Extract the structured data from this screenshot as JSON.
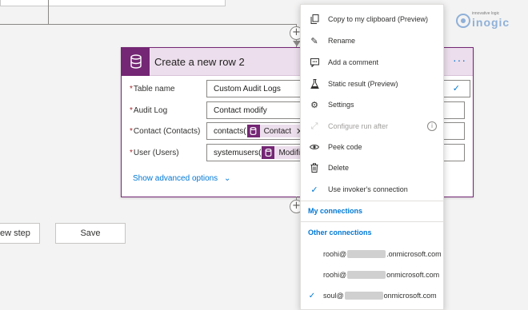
{
  "card": {
    "title": "Create a new row 2",
    "more_label": "···",
    "fields": [
      {
        "label": "Table name",
        "value": "Custom Audit Logs"
      },
      {
        "label": "Audit Log",
        "value": "Contact modify"
      },
      {
        "label": "Contact (Contacts)",
        "prefix": "contacts(",
        "token": "Contact"
      },
      {
        "label": "User (Users)",
        "prefix": "systemusers(",
        "token": "Modified"
      }
    ],
    "show_advanced": "Show advanced options",
    "required_mark": "*"
  },
  "buttons": {
    "new_step": "New step",
    "save": "Save"
  },
  "logo": {
    "tagline": "innovative logic",
    "word": "inogic"
  },
  "menu": {
    "items": [
      {
        "label": "Copy to my clipboard (Preview)",
        "icon": "copy-icon"
      },
      {
        "label": "Rename",
        "icon": "pencil-icon"
      },
      {
        "label": "Add a comment",
        "icon": "comment-icon"
      },
      {
        "label": "Static result (Preview)",
        "icon": "flask-icon"
      },
      {
        "label": "Settings",
        "icon": "gear-icon"
      },
      {
        "label": "Configure run after",
        "icon": "link-icon",
        "disabled": true
      },
      {
        "label": "Peek code",
        "icon": "eye-icon"
      },
      {
        "label": "Delete",
        "icon": "trash-icon"
      },
      {
        "label": "Use invoker's connection",
        "icon": "check-icon"
      }
    ],
    "my_connections": "My connections",
    "other_connections": "Other connections",
    "connections": [
      {
        "prefix": "roohi@",
        "suffix": ".onmicrosoft.com",
        "selected": false
      },
      {
        "prefix": "roohi@",
        "suffix": "onmicrosoft.com",
        "selected": false
      },
      {
        "prefix": "soul@",
        "suffix": "onmicrosoft.com",
        "selected": true
      }
    ]
  },
  "colors": {
    "accent": "#742774",
    "link": "#0078d4"
  }
}
